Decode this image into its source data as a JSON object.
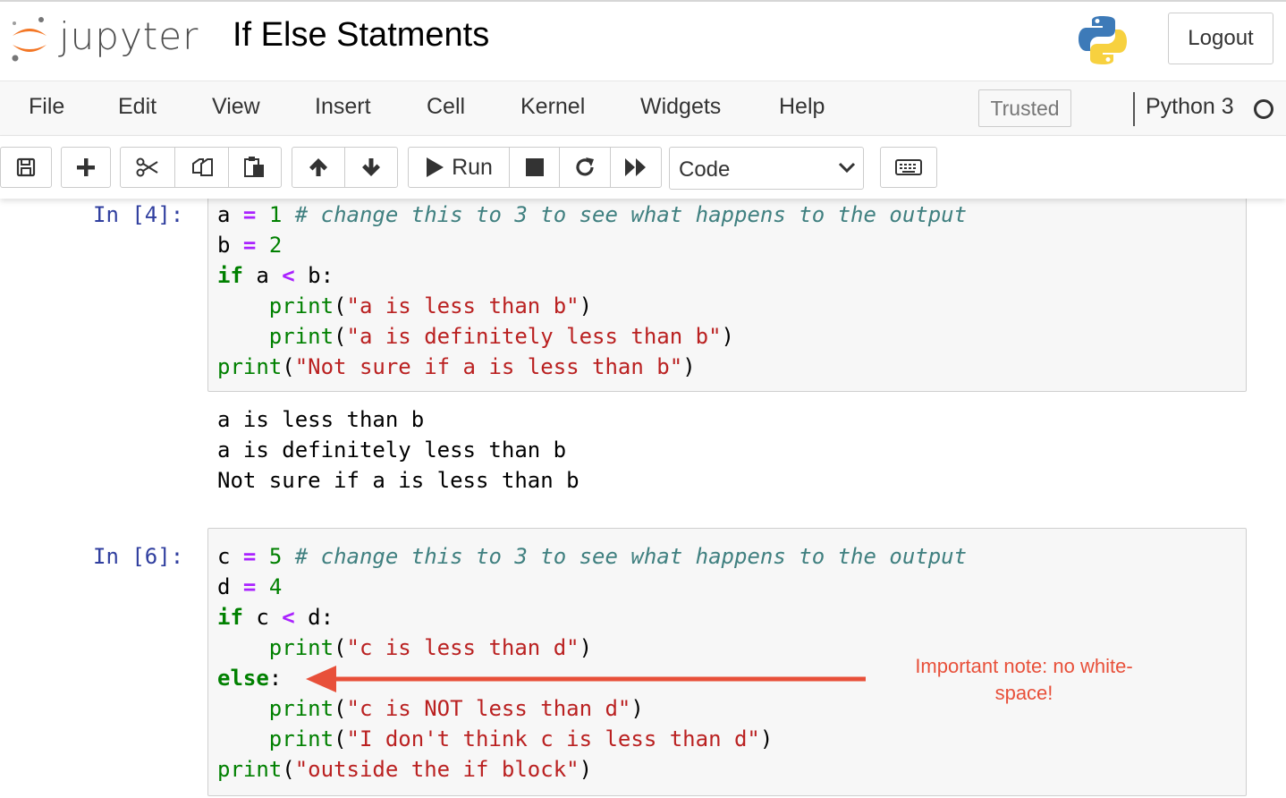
{
  "header": {
    "app_name": "jupyter",
    "notebook_title": "If Else Statments",
    "logout_label": "Logout"
  },
  "menu": {
    "items": [
      "File",
      "Edit",
      "View",
      "Insert",
      "Cell",
      "Kernel",
      "Widgets",
      "Help"
    ],
    "trusted_label": "Trusted",
    "kernel_name": "Python 3"
  },
  "toolbar": {
    "run_label": "Run",
    "cell_type": "Code",
    "icons": [
      "save-icon",
      "plus-icon",
      "cut-icon",
      "copy-icon",
      "paste-icon",
      "arrow-up-icon",
      "arrow-down-icon",
      "run-icon",
      "stop-icon",
      "restart-icon",
      "fast-forward-icon",
      "keyboard-icon"
    ]
  },
  "cells": [
    {
      "prompt": "In [4]:",
      "outputs": [
        "a is less than b",
        "a is definitely less than b",
        "Not sure if a is less than b"
      ]
    },
    {
      "prompt": "In [6]:",
      "outputs": []
    }
  ],
  "annotation": {
    "note_line1": "Important note: no white-",
    "note_line2": "space!",
    "color": "#e8503a"
  }
}
